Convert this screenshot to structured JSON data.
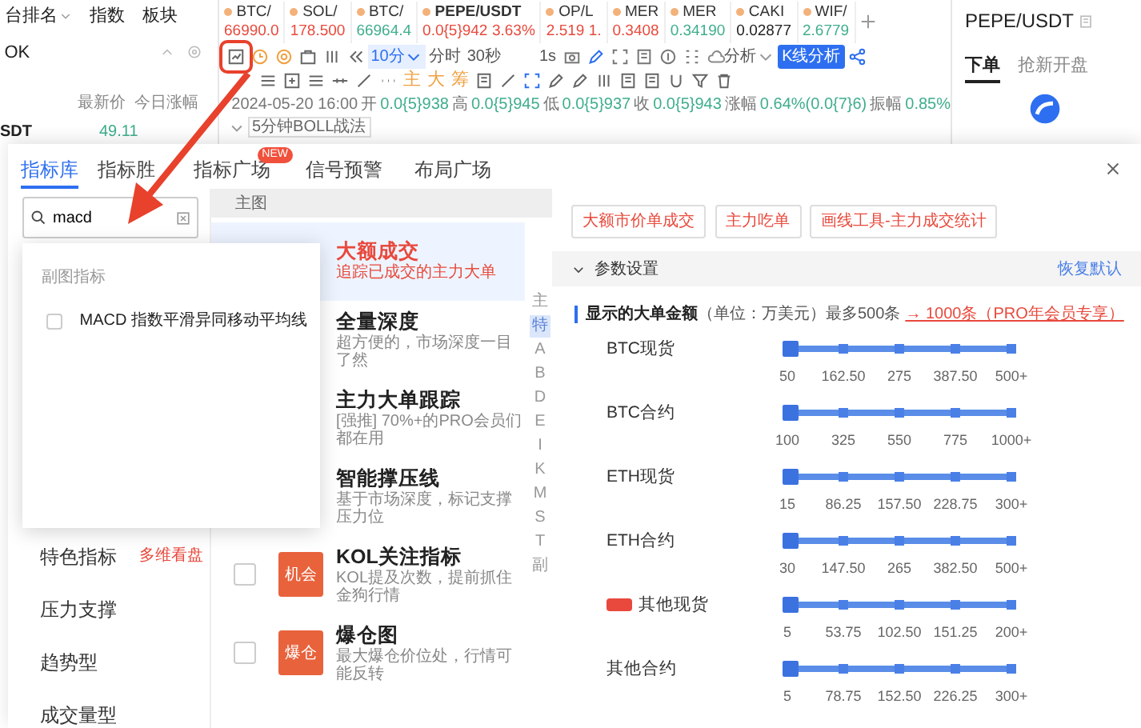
{
  "left_panel": {
    "tabs": [
      "台排名",
      "指数",
      "板块"
    ],
    "filter": "OK",
    "columns": [
      "最新价",
      "今日涨幅"
    ],
    "rows": [
      {
        "symbol": "SDT",
        "price": "49.11"
      }
    ]
  },
  "tickers": [
    {
      "symbol": "BTC/",
      "price": "66990.0",
      "color": "#e8493c"
    },
    {
      "symbol": "SOL/",
      "price": "178.500",
      "color": "#e8493c"
    },
    {
      "symbol": "BTC/",
      "price": "66964.4",
      "color": "#3fae8c"
    },
    {
      "symbol": "PEPE/USDT",
      "price": "0.0{5}942",
      "change": "3.63%",
      "color": "#e8493c"
    },
    {
      "symbol": "OP/L",
      "price": "2.519 1.",
      "color": "#e8493c"
    },
    {
      "symbol": "MER",
      "price": "0.3408",
      "color": "#e8493c"
    },
    {
      "symbol": "MER",
      "price": "0.34190",
      "color": "#3fae8c"
    },
    {
      "symbol": "CAKI",
      "price": "0.02877",
      "color": "#222222"
    },
    {
      "symbol": "WIF/",
      "price": "2.6779",
      "color": "#3fae8c"
    }
  ],
  "toolbar": {
    "intervals": [
      {
        "label": "10分",
        "selected": true
      },
      {
        "label": "分时",
        "selected": false
      },
      {
        "label": "30秒",
        "selected": false
      },
      {
        "label": "1s",
        "selected": false
      }
    ],
    "analysis_menu": "分析",
    "kline_button": "K线分析",
    "overlay_labels": [
      "主",
      "大",
      "筹"
    ]
  },
  "bar_info": {
    "date": "2024-05-20 16:00",
    "values": [
      {
        "label": "开",
        "value": "0.0{5}938"
      },
      {
        "label": "高",
        "value": "0.0{5}945"
      },
      {
        "label": "低",
        "value": "0.0{5}937"
      },
      {
        "label": "收",
        "value": "0.0{5}943"
      },
      {
        "label": "涨幅",
        "value": "0.64%(0.0{7}6)"
      },
      {
        "label": "振幅",
        "value": "0.85%"
      }
    ],
    "strategy": "5分钟BOLL战法"
  },
  "right_panel": {
    "pair": "PEPE/USDT",
    "tabs": [
      {
        "label": "下单",
        "selected": true
      },
      {
        "label": "抢新开盘",
        "selected": false
      }
    ]
  },
  "dialog": {
    "tabs": [
      {
        "label": "指标库",
        "selected": true
      },
      {
        "label": "指标胜",
        "selected": false
      },
      {
        "label": "指标广场",
        "selected": false,
        "badge": "NEW"
      },
      {
        "label": "信号预警",
        "selected": false
      },
      {
        "label": "布局广场",
        "selected": false
      }
    ],
    "search": {
      "value": "macd"
    },
    "search_results": {
      "section": "副图指标",
      "items": [
        {
          "label": "MACD 指数平滑异同移动平均线",
          "checked": false
        }
      ]
    },
    "categories": [
      {
        "label": "特色指标",
        "tag": "多维看盘"
      },
      {
        "label": "压力支撑"
      },
      {
        "label": "趋势型"
      },
      {
        "label": "成交量型"
      }
    ],
    "main_header": "主图",
    "indicators": [
      {
        "title": "大额成交",
        "description": "追踪已成交的主力大单",
        "selected": true
      },
      {
        "title": "全量深度",
        "description": "超方便的，市场深度一目了然",
        "selected": false
      },
      {
        "title": "主力大单跟踪",
        "description": "[强推] 70%+的PRO会员们都在用",
        "selected": false
      },
      {
        "title": "智能撑压线",
        "description": "基于市场深度，标记支撑压力位",
        "selected": false
      },
      {
        "title": "KOL关注指标",
        "description": "KOL提及次数，提前抓住金狗行情",
        "selected": false,
        "checked": false,
        "badge": "机会"
      },
      {
        "title": "爆仓图",
        "description": "最大爆仓价位处，行情可能反转",
        "selected": false,
        "checked": false,
        "badge": "爆仓"
      }
    ],
    "index_letters": [
      {
        "label": "主",
        "selected": false
      },
      {
        "label": "特",
        "selected": true
      },
      {
        "label": "A",
        "selected": false
      },
      {
        "label": "B",
        "selected": false
      },
      {
        "label": "D",
        "selected": false
      },
      {
        "label": "E",
        "selected": false
      },
      {
        "label": "I",
        "selected": false
      },
      {
        "label": "K",
        "selected": false
      },
      {
        "label": "M",
        "selected": false
      },
      {
        "label": "S",
        "selected": false
      },
      {
        "label": "T",
        "selected": false
      },
      {
        "label": "副",
        "selected": false
      }
    ],
    "related_tags": [
      "大额市价单成交",
      "主力吃单",
      "画线工具-主力成交统计"
    ],
    "params": {
      "title": "参数设置",
      "expanded": true,
      "reset": "恢复默认",
      "heading": "**显示的大单金额**（单位：万美元）最多500条",
      "upgrade_link": "→ 1000条（PRO年会员专享）",
      "sliders": [
        {
          "label": "BTC现货",
          "level": 0,
          "ticks": [
            "50",
            "162.50",
            "275",
            "387.50",
            "500+"
          ]
        },
        {
          "label": "BTC合约",
          "level": 0,
          "ticks": [
            "100",
            "325",
            "550",
            "775",
            "1000+"
          ]
        },
        {
          "label": "ETH现货",
          "level": 0,
          "ticks": [
            "15",
            "86.25",
            "157.50",
            "228.75",
            "300+"
          ]
        },
        {
          "label": "ETH合约",
          "level": 0,
          "ticks": [
            "30",
            "147.50",
            "265",
            "382.50",
            "500+"
          ]
        },
        {
          "label": "其他现货",
          "level": 0,
          "hot_tag": true,
          "ticks": [
            "5",
            "53.75",
            "102.50",
            "151.25",
            "200+"
          ]
        },
        {
          "label": "其他合约",
          "level": 0,
          "ticks": [
            "5",
            "78.75",
            "152.50",
            "226.25",
            "300+"
          ]
        }
      ]
    }
  }
}
